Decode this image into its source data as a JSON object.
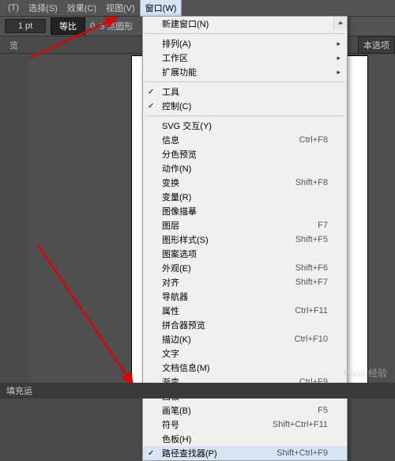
{
  "menubar": [
    "(T)",
    "选择(S)",
    "效果(C)",
    "视图(V)",
    "窗口(W)"
  ],
  "active_menu_index": 4,
  "toolbar": {
    "left_combo": "1 pt",
    "stroke_label": "等比",
    "dot_value": "0",
    "shape_label": "5 点圆形"
  },
  "tab": {
    "label": "览"
  },
  "right_tag": "本选项",
  "dropdown": {
    "groups": [
      {
        "items": [
          {
            "label": "新建窗口(N)"
          }
        ]
      },
      {
        "items": [
          {
            "label": "排列(A)",
            "sub": true
          },
          {
            "label": "工作区",
            "sub": true
          },
          {
            "label": "扩展功能",
            "sub": true
          }
        ]
      },
      {
        "items": [
          {
            "label": "工具",
            "checked": true
          },
          {
            "label": "控制(C)",
            "checked": true
          }
        ]
      },
      {
        "items": [
          {
            "label": "SVG 交互(Y)"
          },
          {
            "label": "信息",
            "shortcut": "Ctrl+F8"
          },
          {
            "label": "分色预览"
          },
          {
            "label": "动作(N)"
          },
          {
            "label": "变换",
            "shortcut": "Shift+F8"
          },
          {
            "label": "变量(R)"
          },
          {
            "label": "图像描摹"
          },
          {
            "label": "图层",
            "shortcut": "F7"
          },
          {
            "label": "图形样式(S)",
            "shortcut": "Shift+F5"
          },
          {
            "label": "图案选项"
          },
          {
            "label": "外观(E)",
            "shortcut": "Shift+F6"
          },
          {
            "label": "对齐",
            "shortcut": "Shift+F7"
          },
          {
            "label": "导航器"
          },
          {
            "label": "属性",
            "shortcut": "Ctrl+F11"
          },
          {
            "label": "拼合器预览"
          },
          {
            "label": "描边(K)",
            "shortcut": "Ctrl+F10"
          },
          {
            "label": "文字"
          },
          {
            "label": "文档信息(M)"
          },
          {
            "label": "渐变",
            "shortcut": "Ctrl+F9"
          },
          {
            "label": "画板"
          },
          {
            "label": "画笔(B)",
            "shortcut": "F5"
          },
          {
            "label": "符号",
            "shortcut": "Shift+Ctrl+F11"
          },
          {
            "label": "色板(H)"
          },
          {
            "label": "路径查找器(P)",
            "shortcut": "Shift+Ctrl+F9",
            "checked": true,
            "highlight": true
          }
        ]
      }
    ]
  },
  "status": "填充运",
  "watermark": "Baidu经验"
}
